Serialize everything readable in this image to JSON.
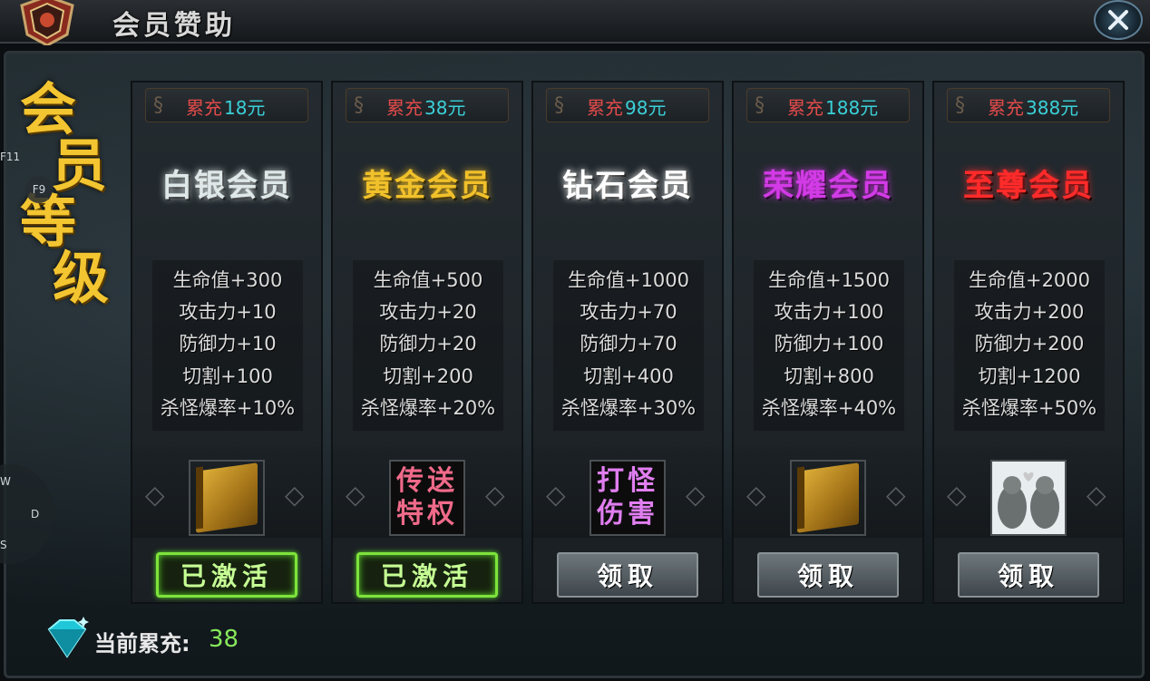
{
  "window": {
    "title": "会员赞助",
    "close_icon": "close-icon"
  },
  "side_title": [
    "会",
    "员",
    "等",
    "级"
  ],
  "hotkeys": {
    "f11": "F11",
    "f9": "F9",
    "w": "W",
    "d": "D",
    "s": "S"
  },
  "cards": [
    {
      "req_label": "累充",
      "req_value": "18元",
      "name": "白银会员",
      "name_color": "#dfe8e8",
      "attrs": [
        "生命值+300",
        "攻击力+10",
        "防御力+10",
        "切割+100",
        "杀怪爆率+10%"
      ],
      "reward": {
        "type": "book",
        "icon": "book-icon"
      },
      "button": {
        "label": "已激活",
        "state": "activated"
      }
    },
    {
      "req_label": "累充",
      "req_value": "38元",
      "name": "黄金会员",
      "name_color": "#f1c12b",
      "attrs": [
        "生命值+500",
        "攻击力+20",
        "防御力+20",
        "切割+200",
        "杀怪爆率+20%"
      ],
      "reward": {
        "type": "text",
        "line1": "传送",
        "line2": "特权",
        "color": "#f06a8a"
      },
      "button": {
        "label": "已激活",
        "state": "activated"
      }
    },
    {
      "req_label": "累充",
      "req_value": "98元",
      "name": "钻石会员",
      "name_color": "#ffffff",
      "attrs": [
        "生命值+1000",
        "攻击力+70",
        "防御力+70",
        "切割+400",
        "杀怪爆率+30%"
      ],
      "reward": {
        "type": "text",
        "line1": "打怪",
        "line2": "伤害",
        "color": "#e07ef0"
      },
      "button": {
        "label": "领取",
        "state": "claim"
      }
    },
    {
      "req_label": "累充",
      "req_value": "188元",
      "name": "荣耀会员",
      "name_color": "#d23be6",
      "attrs": [
        "生命值+1500",
        "攻击力+100",
        "防御力+100",
        "切割+800",
        "杀怪爆率+40%"
      ],
      "reward": {
        "type": "book",
        "icon": "book-icon"
      },
      "button": {
        "label": "领取",
        "state": "claim"
      }
    },
    {
      "req_label": "累充",
      "req_value": "388元",
      "name": "至尊会员",
      "name_color": "#ff2b2b",
      "attrs": [
        "生命值+2000",
        "攻击力+200",
        "防御力+200",
        "切割+1200",
        "杀怪爆率+50%"
      ],
      "reward": {
        "type": "image",
        "icon": "wolf-pair-icon"
      },
      "button": {
        "label": "领取",
        "state": "claim"
      }
    }
  ],
  "footer": {
    "label": "当前累充:",
    "value": "38",
    "icon": "diamond-icon"
  }
}
